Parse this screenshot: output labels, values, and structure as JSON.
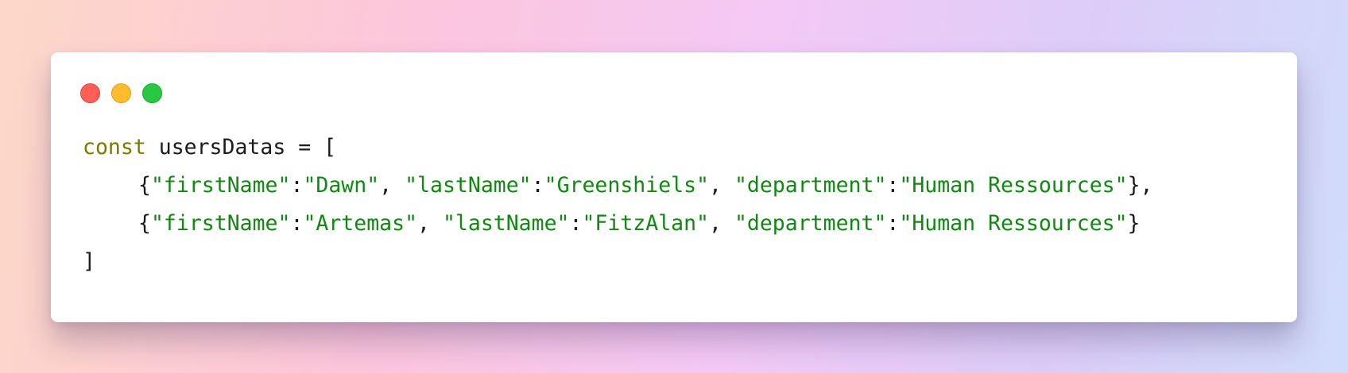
{
  "window": {
    "controls": [
      "close",
      "minimize",
      "maximize"
    ],
    "colors": {
      "close": "#ff5f57",
      "minimize": "#febc2e",
      "maximize": "#28c840",
      "keyword": "#7a7a00",
      "string": "#118811",
      "text": "#1b1b1b"
    }
  },
  "code": {
    "line1": {
      "keyword": "const",
      "rest": " usersDatas = ["
    },
    "line2": {
      "open": "{",
      "k1": "\"firstName\"",
      "c1": ":",
      "v1": "\"Dawn\"",
      "s1": ", ",
      "k2": "\"lastName\"",
      "c2": ":",
      "v2": "\"Greenshiels\"",
      "s2": ", ",
      "k3": "\"department\"",
      "c3": ":",
      "v3": "\"Human Ressources\"",
      "close": "},"
    },
    "line3": {
      "open": "{",
      "k1": "\"firstName\"",
      "c1": ":",
      "v1": "\"Artemas\"",
      "s1": ", ",
      "k2": "\"lastName\"",
      "c2": ":",
      "v2": "\"FitzAlan\"",
      "s2": ", ",
      "k3": "\"department\"",
      "c3": ":",
      "v3": "\"Human Ressources\"",
      "close": "}"
    },
    "line4": {
      "close": "]"
    }
  }
}
